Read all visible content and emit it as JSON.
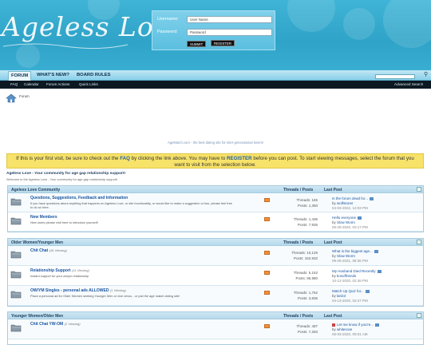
{
  "header": {
    "logo": "Ageless Love",
    "login": {
      "username_label": "Username:",
      "username_value": "User Name",
      "password_label": "Password:",
      "password_value": "Password",
      "submit": "SUBMIT",
      "register": "REGISTER"
    }
  },
  "nav": {
    "tabs": [
      "FORUM",
      "WHAT'S NEW?",
      "BOARD RULES"
    ],
    "sub": [
      "FAQ",
      "Calendar",
      "Forum Actions",
      "Quick Links"
    ],
    "advanced_search": "Advanced Search"
  },
  "breadcrumb": "Forum",
  "banner_alt": "AgeMatch.com - the best dating site for inter-generational lovers!",
  "notice": {
    "part1": "If this is your first visit, be sure to check out the",
    "faq": "FAQ",
    "part2": "by clicking the link above. You may have to",
    "register": "REGISTER",
    "part3": "before you can post. To start viewing messages, select the forum that you want to visit from the selection below."
  },
  "welcome": {
    "title": "Ageless Love - Your community for age gap relationship support!",
    "sub": "Welcome to the Ageless Love - Your community for age gap relationship support!"
  },
  "sections": [
    {
      "title": "Ageless Love Community",
      "col_threads": "Threads / Posts",
      "col_last": "Last Post",
      "forums": [
        {
          "title": "Questions, Suggestions, Feedback and Information",
          "viewing": "",
          "desc": "If you have questions about anything that happens on Ageless Love, or site functionality, or would like to make a suggestion or two, please feel free to do so here.",
          "threads": "Threads: 165",
          "posts": "Posts: 1,360",
          "lp_title": "Is the forum dead for...",
          "lp_by": "wolfstoner",
          "lp_date": "04-03-2022, 12:03 PM"
        },
        {
          "title": "New Members",
          "viewing": "",
          "desc": "New users please visit here to introduce yourself!",
          "threads": "Threads: 1,436",
          "posts": "Posts: 7,935",
          "lp_title": "Hello everyone",
          "lp_by": "Slow Worm",
          "lp_date": "05-29-2020, 03:17 PM"
        }
      ]
    },
    {
      "title": "Older Women/Younger Men",
      "col_threads": "Threads / Posts",
      "col_last": "Last Post",
      "forums": [
        {
          "title": "Chit Chat",
          "viewing": "(36 Viewing)",
          "desc": "",
          "threads": "Threads: 10,129",
          "posts": "Posts: 162,932",
          "lp_title": "What is the biggest age...",
          "lp_by": "Slow Worm",
          "lp_date": "09-25-2021, 08:36 PM"
        },
        {
          "title": "Relationship Support",
          "viewing": "(11 Viewing)",
          "desc": "Instant support for your ow/ym relationship",
          "threads": "Threads: 5,152",
          "posts": "Posts: 95,980",
          "lp_title": "My Husband Died Recently",
          "lp_by": "kosoffriends",
          "lp_date": "10-12-2020, 02:46 PM"
        },
        {
          "title": "OW/YM Singles - personal ads ALLOWED",
          "viewing": "(1 Viewing)",
          "desc": "Place a personal ad for Older Women seeking Younger Men or vice versa... or just the age match dating site!",
          "threads": "Threads: 1,762",
          "posts": "Posts: 3,836",
          "lp_title": "Match Up Quiz for...",
          "lp_by": "lari23",
          "lp_date": "04-13-2020, 03:47 PM"
        }
      ]
    },
    {
      "title": "Younger Women/Older Men",
      "col_threads": "Threads / Posts",
      "col_last": "Last Post",
      "forums": [
        {
          "title": "Chit Chat YW-OM",
          "viewing": "(2 Viewing)",
          "desc": "",
          "threads": "Threads: 487",
          "posts": "Posts: 7,283",
          "lp_title": "Let me know if you're...",
          "lp_by": "whiterose",
          "lp_date": "06-03-2020, 09:01 AM"
        }
      ]
    }
  ],
  "colors": {
    "header": "#2fa3c8",
    "subnav": "#0c1922",
    "notice": "#f7e36a",
    "link": "#1a55a2"
  }
}
